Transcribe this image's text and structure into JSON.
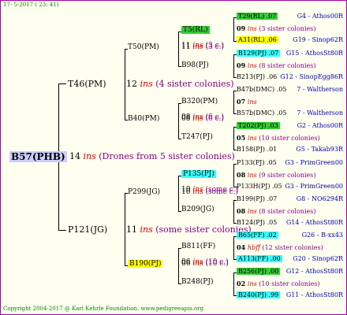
{
  "header": "17-  5-2017 ( 23: 41)",
  "footer": "Copyright 2004-2017 @ Karl Kehrle Foundation.   www.pedigreeapis.org",
  "colors": {
    "root": "#ccccff",
    "green": "#33cc33",
    "yellow": "#ffff00",
    "cyan": "#33ffff",
    "ins": "#d00000",
    "note": "#800080"
  },
  "root": {
    "id": "B57(PHB)",
    "n": "14",
    "ins": "ins",
    "note": "(Drones from 5 sister colonies)"
  },
  "g1": [
    {
      "id": "T46(PM)",
      "n": "12",
      "ins": "ins",
      "note": "(4 sister colonies)"
    },
    {
      "id": "P121(JG)",
      "n": "11",
      "ins": "ins",
      "note": "(some sister colonies)"
    }
  ],
  "g2": [
    {
      "id": "T50(PM)",
      "n": "11",
      "ins": "ins",
      "note": "(3 c.)"
    },
    {
      "id": "B40(PM)",
      "n": "08",
      "ins": "ins",
      "note": "(6 c.)"
    },
    {
      "id": "P299(JG)",
      "n": "10",
      "ins": "ins",
      "note": "(some c.)"
    },
    {
      "id": "B190(PJ)",
      "n": "06",
      "ins": "ins",
      "note": "(10 c.)"
    }
  ],
  "g3": [
    {
      "id": "T5(RL)",
      "n": "11",
      "ins": "ins",
      "note": "(3 c.)"
    },
    {
      "id": "B98(PJ)"
    },
    {
      "id": "B320(PM)",
      "n": "08",
      "ins": "ins",
      "note": "(6 c.)"
    },
    {
      "id": "T247(PJ)"
    },
    {
      "id": "P135(PJ)",
      "n": "10",
      "ins": "ins",
      "note": "(some c.)"
    },
    {
      "id": "B209(JG)"
    },
    {
      "id": "B811(FF)",
      "n": "06",
      "ins": "ins",
      "note": "(10 c.)"
    },
    {
      "id": "B248(PJ)"
    }
  ],
  "g4": [
    {
      "top": "T29(RL) .07",
      "topRight": "G4 - Athos00R",
      "n": "09",
      "ins": "ins",
      "note": "(3 sister colonies)",
      "bottom": "A31(RL) .06",
      "bottomRight": "G19 - Sinop62R"
    },
    {
      "top": "B129(PJ) .07",
      "topRight": "G15 - AthosSt80R",
      "n": "09",
      "ins": "ins",
      "note": "(8 sister colonies)",
      "bottom": "B213(PJ) .06",
      "bottomRight": "G12 - SinopEgg86R"
    },
    {
      "top": "B47b(DMC) .05",
      "topRight": "7 - Waltherson",
      "n": "07",
      "ins": "ins",
      "note": "",
      "bottom": "B57b(DMC) .05",
      "bottomRight": "7 - Waltherson"
    },
    {
      "top": "T202(PJ) .03",
      "topRight": "G2 - Athos00R",
      "n": "05",
      "ins": "ins",
      "note": "(10 sister colonies)",
      "bottom": "B158(PJ) .01",
      "bottomRight": "G5 - Takab93R"
    },
    {
      "top": "P133(PJ) .05",
      "topRight": "G3 - PrimGreen00",
      "n": "08",
      "ins": "ins",
      "note": "(9 sister colonies)",
      "bottom": "P133H(PJ) .05",
      "bottomRight": "G3 - PrimGreen00"
    },
    {
      "top": "B199(PJ) .07",
      "topRight": "G8 - NO6294R",
      "n": "08",
      "ins": "ins",
      "note": "(8 sister colonies)",
      "bottom": "B124(PJ) .05",
      "bottomRight": "G14 - AthosSt80R"
    },
    {
      "top": "B65(FF) .02",
      "topRight": "G26 - B-xx43",
      "n": "04",
      "ins": "hbff",
      "note": "(12 sister colonies)",
      "bottom": "A113(FF) .00",
      "bottomRight": "G20 - Sinop62R"
    },
    {
      "top": "B256(PJ) .00",
      "topRight": "G12 - AthosSt80R",
      "n": "02",
      "ins": "ins",
      "note": "(10 sister colonies)",
      "bottom": "B240(PJ) .99",
      "bottomRight": "G11 - AthosSt80R"
    }
  ]
}
